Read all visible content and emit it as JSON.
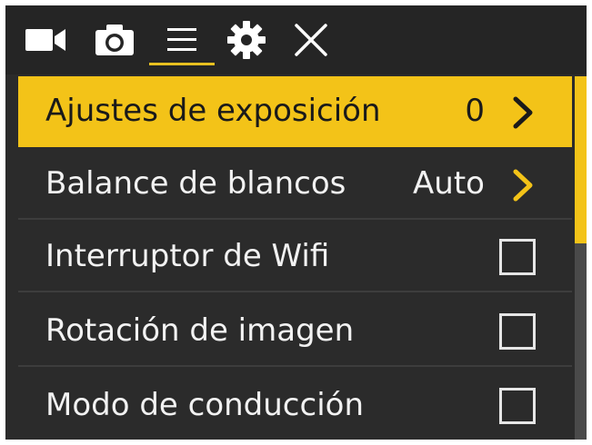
{
  "toolbar": {
    "tabs": [
      {
        "icon": "video-camera-icon"
      },
      {
        "icon": "photo-camera-icon"
      },
      {
        "icon": "menu-icon",
        "active": true
      },
      {
        "icon": "gear-icon"
      },
      {
        "icon": "close-icon"
      }
    ]
  },
  "menu": {
    "items": [
      {
        "label": "Ajustes de exposición",
        "value": "0",
        "control": "chevron",
        "selected": true
      },
      {
        "label": "Balance de blancos",
        "value": "Auto",
        "control": "chevron"
      },
      {
        "label": "Interruptor de Wifi",
        "control": "checkbox",
        "checked": false
      },
      {
        "label": "Rotación de imagen",
        "control": "checkbox",
        "checked": false
      },
      {
        "label": "Modo de conducción",
        "control": "checkbox",
        "checked": false
      }
    ]
  },
  "colors": {
    "accent": "#f3c318",
    "background": "#2b2b2b",
    "text": "#f2f2f2"
  }
}
